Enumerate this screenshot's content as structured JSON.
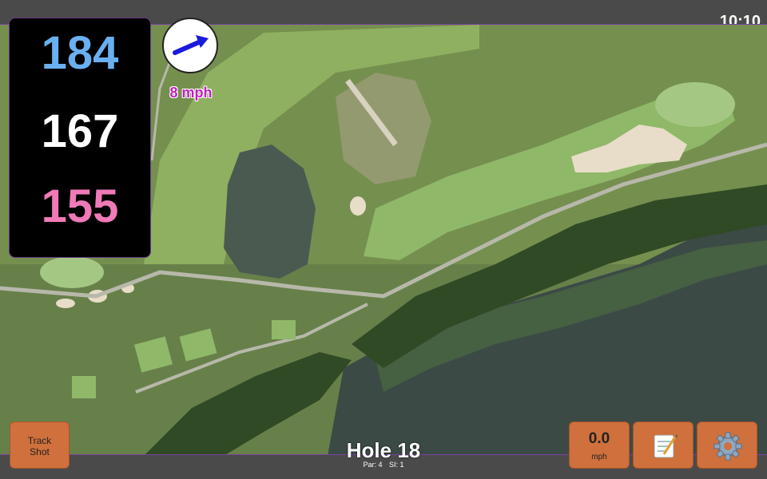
{
  "status": {
    "time": "10:10"
  },
  "distances": {
    "back": "184",
    "middle": "167",
    "front": "155",
    "colors": {
      "back": "#6ab0f0",
      "middle": "#ffffff",
      "front": "#f07ab8"
    }
  },
  "wind": {
    "speed": "8 mph",
    "arrow_icon": "arrow-right-icon",
    "speed_color": "#c020c0",
    "arrow_color": "#1a1adc"
  },
  "buttons": {
    "track_shot": "Track\nShot",
    "speed_value": "0.0",
    "speed_unit": "mph",
    "notes_icon": "notepad-icon",
    "settings_icon": "gear-icon",
    "accent": "#d0703c"
  },
  "hole": {
    "title": "Hole 18",
    "par": "Par: 4",
    "si": "SI: 1"
  }
}
